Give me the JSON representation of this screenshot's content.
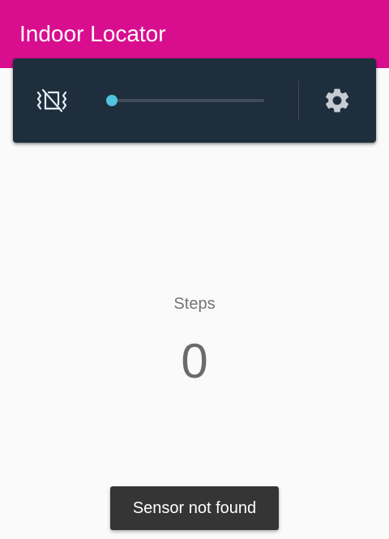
{
  "app": {
    "title": "Indoor Locator",
    "brand_color": "#d90e8f"
  },
  "control_card": {
    "background_color": "#1f2e3d",
    "vibrate_icon": "vibration-off-icon",
    "settings_icon": "gear-icon",
    "slider": {
      "value": 0,
      "accent_color": "#4fc3e0"
    }
  },
  "steps": {
    "label": "Steps",
    "count": "0"
  },
  "toast": {
    "message": "Sensor not found"
  }
}
